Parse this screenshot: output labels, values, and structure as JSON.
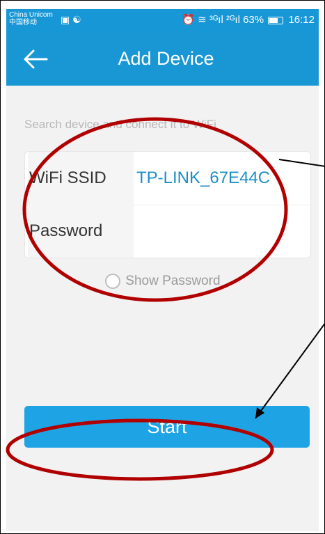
{
  "status_bar": {
    "carrier_line1": "China Unicom",
    "carrier_line2": "中国移动",
    "left_icons": "▣ ☯",
    "network": "⏰ ≋ ³ᴳıl ²ᴳıl",
    "battery_percent": "63%",
    "time": "16:12"
  },
  "app_bar": {
    "title": "Add Device",
    "back_icon": "arrow-left-icon"
  },
  "form": {
    "hint": "Search device and connect it to WiFi",
    "ssid_label": "WiFi SSID",
    "ssid_value": "TP-LINK_67E44C",
    "password_label": "Password",
    "password_value": "",
    "show_password_label": "Show Password"
  },
  "actions": {
    "start_label": "Start"
  },
  "colors": {
    "primary": "#1997d5",
    "button": "#1ea3e5",
    "annotation": "#b00000"
  }
}
